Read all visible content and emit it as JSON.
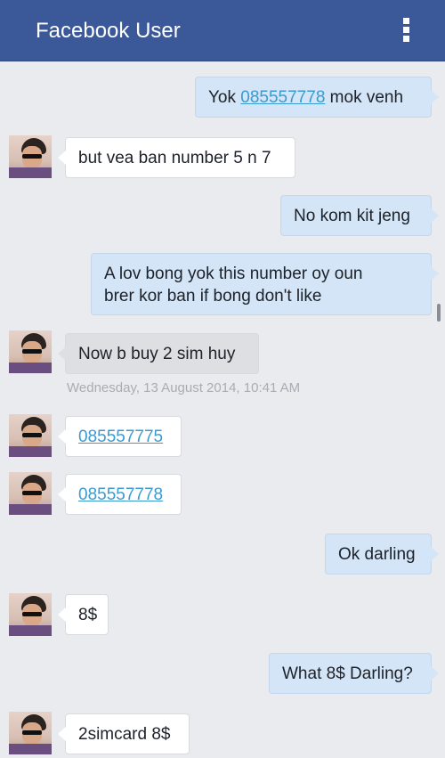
{
  "header": {
    "title": "Facebook User",
    "menu_icon": "vertical-ellipsis-icon"
  },
  "messages": [
    {
      "direction": "out",
      "parts": [
        "Yok ",
        "085557778",
        " mok venh"
      ]
    },
    {
      "direction": "in",
      "text": "but vea ban number 5 n 7"
    },
    {
      "direction": "out",
      "text": "No kom kit jeng"
    },
    {
      "direction": "out",
      "lines": [
        "A lov bong yok this number oy oun",
        "brer kor ban if bong don't like"
      ]
    },
    {
      "direction": "in",
      "text": "Now b buy 2 sim huy"
    },
    {
      "direction": "in",
      "text": "085557775"
    },
    {
      "direction": "in",
      "text": "085557778"
    },
    {
      "direction": "out",
      "text": "Ok darling"
    },
    {
      "direction": "in",
      "text": "8$"
    },
    {
      "direction": "out",
      "text": "What 8$ Darling?"
    },
    {
      "direction": "in",
      "text": "2simcard 8$"
    }
  ],
  "timestamp": "Wednesday, 13 August 2014, 10:41 AM",
  "colors": {
    "header_bg": "#3b5998",
    "chat_bg": "#e9ebee",
    "outgoing_bubble": "#d3e5f6",
    "incoming_bubble": "#ffffff",
    "link": "#3a9bd1"
  }
}
